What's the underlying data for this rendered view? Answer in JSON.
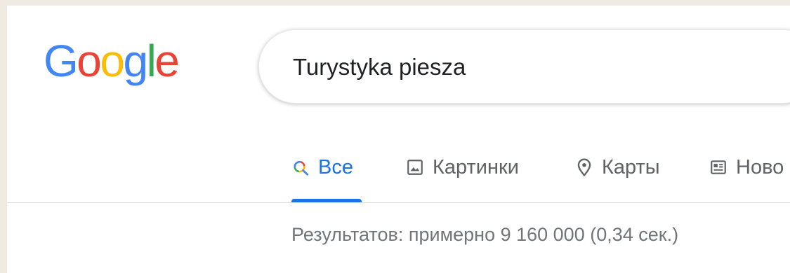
{
  "logo": {
    "letters": [
      "G",
      "o",
      "o",
      "g",
      "l",
      "e"
    ],
    "colors": [
      "#4285f4",
      "#ea4335",
      "#fbbc05",
      "#4285f4",
      "#34a853",
      "#ea4335"
    ]
  },
  "search": {
    "value": "Turystyka piesza"
  },
  "tabs": [
    {
      "label": "Все",
      "icon": "search-icon",
      "active": true
    },
    {
      "label": "Картинки",
      "icon": "image-icon",
      "active": false
    },
    {
      "label": "Карты",
      "icon": "map-pin-icon",
      "active": false
    },
    {
      "label": "Ново",
      "icon": "news-icon",
      "active": false
    }
  ],
  "results": {
    "stats": "Результатов: примерно 9 160 000 (0,34 сек.)"
  },
  "colors": {
    "accent": "#1a73e8",
    "muted_text": "#5f6368",
    "stats_text": "#70757a"
  }
}
